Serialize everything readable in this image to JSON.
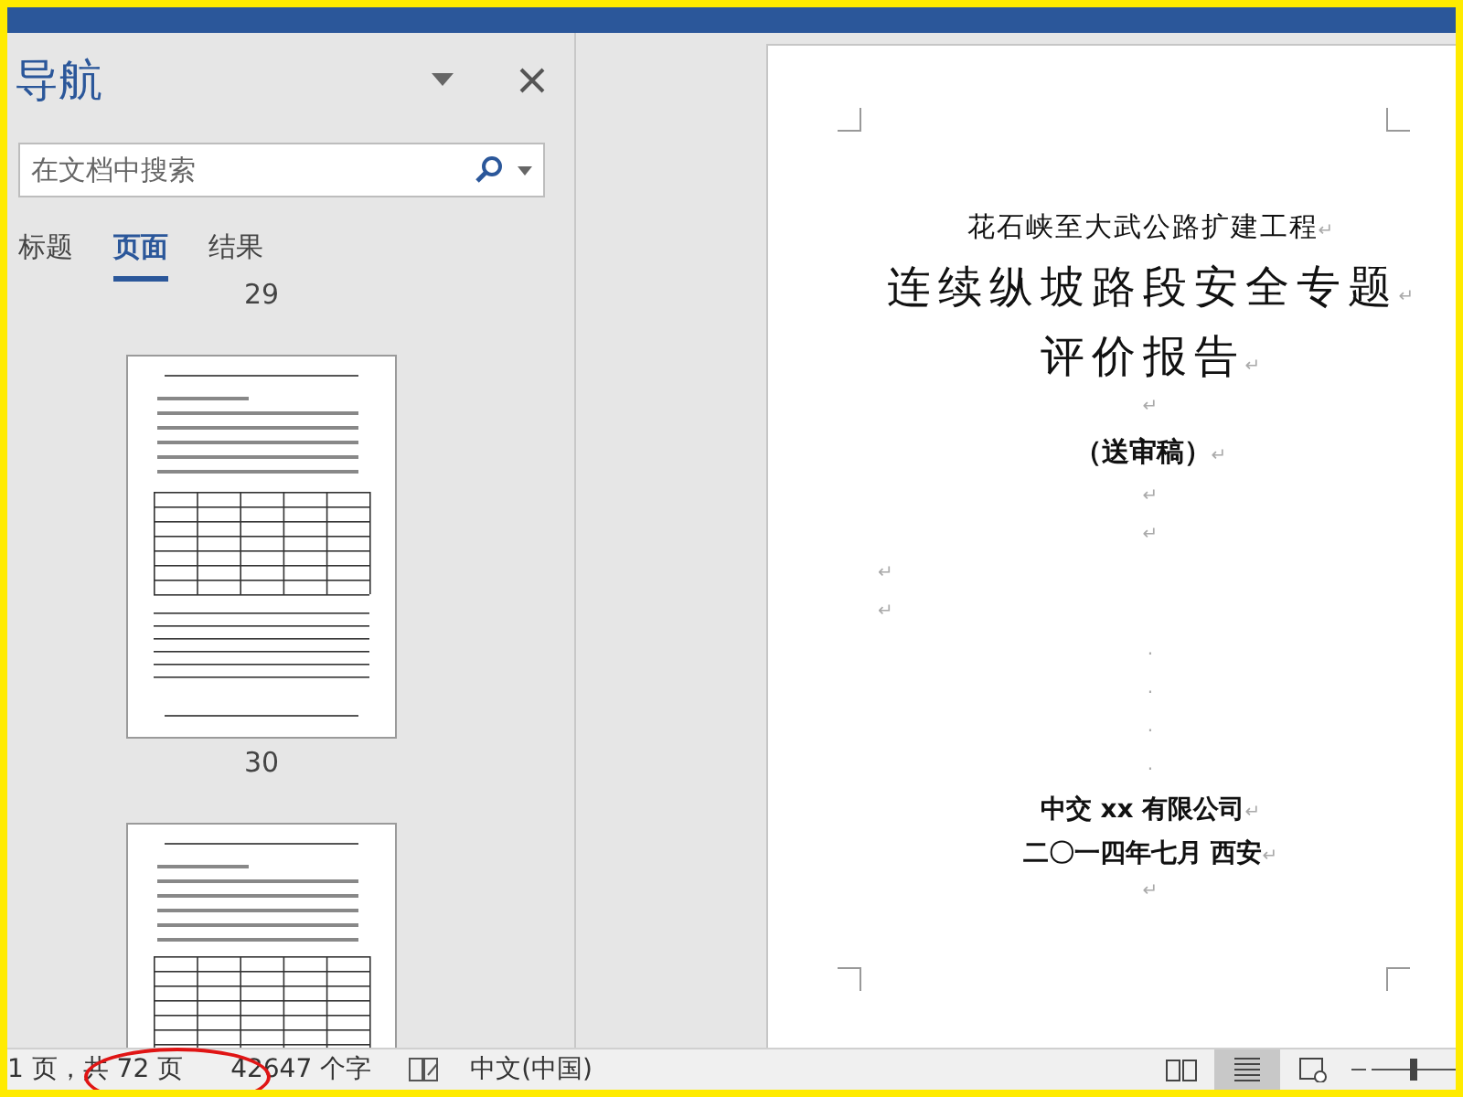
{
  "nav_pane": {
    "title": "导航",
    "search": {
      "placeholder": "在文档中搜索"
    },
    "tabs": [
      {
        "label": "标题",
        "selected": false
      },
      {
        "label": "页面",
        "selected": true
      },
      {
        "label": "结果",
        "selected": false
      }
    ],
    "pages": [
      {
        "number": "29",
        "kind": "partial"
      },
      {
        "number": "30",
        "kind": "tables"
      },
      {
        "kind": "text"
      }
    ]
  },
  "document": {
    "paragraphs": [
      {
        "kind": "subtitle",
        "text": "花石峡至大武公路扩建工程",
        "mark": "↵"
      },
      {
        "kind": "title",
        "text": "连续纵坡路段安全专题",
        "mark": "↵"
      },
      {
        "kind": "title",
        "text": "评价报告",
        "mark": "↵"
      },
      {
        "kind": "empty",
        "mark": "↵"
      },
      {
        "kind": "note",
        "text": "（送审稿）",
        "mark": "↵"
      },
      {
        "kind": "empty",
        "mark": "↵"
      },
      {
        "kind": "empty",
        "mark": "↵"
      },
      {
        "kind": "margin",
        "mark": "↵"
      },
      {
        "kind": "margin",
        "mark": "↵"
      },
      {
        "kind": "empty",
        "mark": "."
      },
      {
        "kind": "empty",
        "mark": "."
      },
      {
        "kind": "empty",
        "mark": "."
      },
      {
        "kind": "empty",
        "mark": "."
      },
      {
        "kind": "sign",
        "text": "中交 xx 有限公司",
        "mark": "↵"
      },
      {
        "kind": "sign",
        "text": "二〇一四年七月  西安",
        "mark": "↵"
      },
      {
        "kind": "empty",
        "mark": "↵"
      }
    ]
  },
  "status_bar": {
    "items": [
      "1 页，共 72 页",
      "42647 个字",
      "中文(中国)"
    ],
    "zoom": {
      "level": 0.5
    },
    "views": [
      {
        "kind": "read",
        "selected": false
      },
      {
        "kind": "print",
        "selected": true
      },
      {
        "kind": "web",
        "selected": false
      }
    ]
  }
}
